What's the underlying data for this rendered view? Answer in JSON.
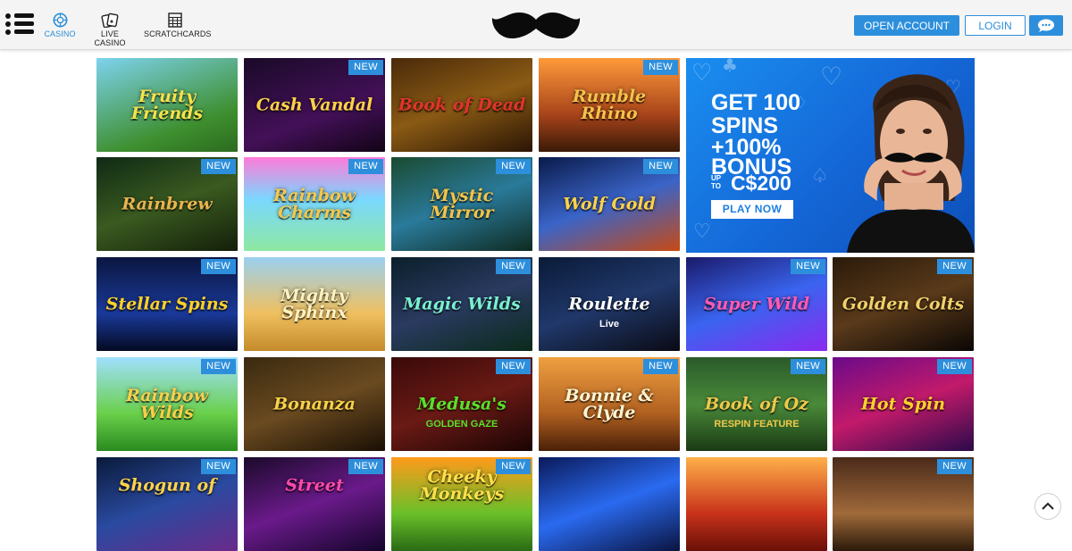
{
  "header": {
    "nav": [
      {
        "label": "CASINO",
        "icon": "casino-chip-icon",
        "active": true
      },
      {
        "label": "LIVE CASINO",
        "icon": "playing-cards-icon",
        "active": false
      },
      {
        "label": "SCRATCHCARDS",
        "icon": "scratchcard-grid-icon",
        "active": false
      }
    ],
    "logo": "mustache-logo",
    "open_account_label": "OPEN ACCOUNT",
    "login_label": "LOGIN",
    "chat_icon": "chat-bubble-icon"
  },
  "colors": {
    "accent": "#2d8fdc",
    "header_bg": "#f4f4f4",
    "page_bg": "#ffffff"
  },
  "badge_label": "NEW",
  "promo": {
    "line1": "GET 100",
    "line2": "SPINS",
    "line3": "+100%",
    "line4": "BONUS",
    "upto": "UP TO",
    "amount": "C$200",
    "cta": "PLAY NOW"
  },
  "games": [
    {
      "title": "Fruity Friends",
      "new": false
    },
    {
      "title": "Cash Vandal",
      "new": true
    },
    {
      "title": "Book of Dead",
      "new": false
    },
    {
      "title": "Rumble Rhino",
      "new": true
    },
    {
      "title": "Rainbrew",
      "new": true
    },
    {
      "title": "Rainbow Charms",
      "new": true
    },
    {
      "title": "Mystic Mirror",
      "new": true
    },
    {
      "title": "Wolf Gold",
      "new": true
    },
    {
      "title": "Stellar Spins",
      "new": true
    },
    {
      "title": "Mighty Sphinx",
      "new": false
    },
    {
      "title": "Magic Wilds",
      "new": true
    },
    {
      "title": "Roulette",
      "subtitle": "Live",
      "new": false
    },
    {
      "title": "Super Wild",
      "new": true
    },
    {
      "title": "Golden Colts",
      "new": true
    },
    {
      "title": "Rainbow Wilds",
      "new": true
    },
    {
      "title": "Bonanza",
      "new": false
    },
    {
      "title": "Medusa's",
      "subtitle": "GOLDEN GAZE",
      "new": true
    },
    {
      "title": "Bonnie & Clyde",
      "new": true
    },
    {
      "title": "Book of Oz",
      "subtitle": "RESPIN FEATURE",
      "new": true
    },
    {
      "title": "Hot Spin",
      "new": true
    },
    {
      "title": "Shogun of",
      "new": true
    },
    {
      "title": "Street",
      "new": true
    },
    {
      "title": "Cheeky Monkeys",
      "new": true
    },
    {
      "title": "",
      "new": false
    },
    {
      "title": "",
      "new": false
    },
    {
      "title": "",
      "new": true
    }
  ]
}
